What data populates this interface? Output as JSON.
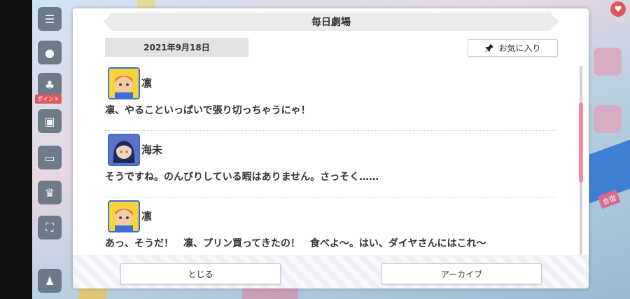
{
  "modal": {
    "title": "毎日劇場",
    "date": "2021年9月18日",
    "favorite_label": "お気に入り"
  },
  "messages": [
    {
      "speaker": "凛",
      "text": "凛、やることいっぱいで張り切っちゃうにゃ！"
    },
    {
      "speaker": "海未",
      "text": "そうですね。のんびりしている暇はありません。さっそく……"
    },
    {
      "speaker": "凛",
      "text": "あっ、そうだ！　凛、プリン買ってきたの！　食べよ～。はい、ダイヤさんにはこれ～"
    }
  ],
  "buttons": {
    "close_label": "とじる",
    "archive_label": "アーカイブ"
  },
  "background": {
    "side_label": "合宿",
    "badge": "ポイント"
  },
  "colors": {
    "scroll_thumb": "#ef8b9c",
    "avatar_border": "#3b6fd6"
  }
}
